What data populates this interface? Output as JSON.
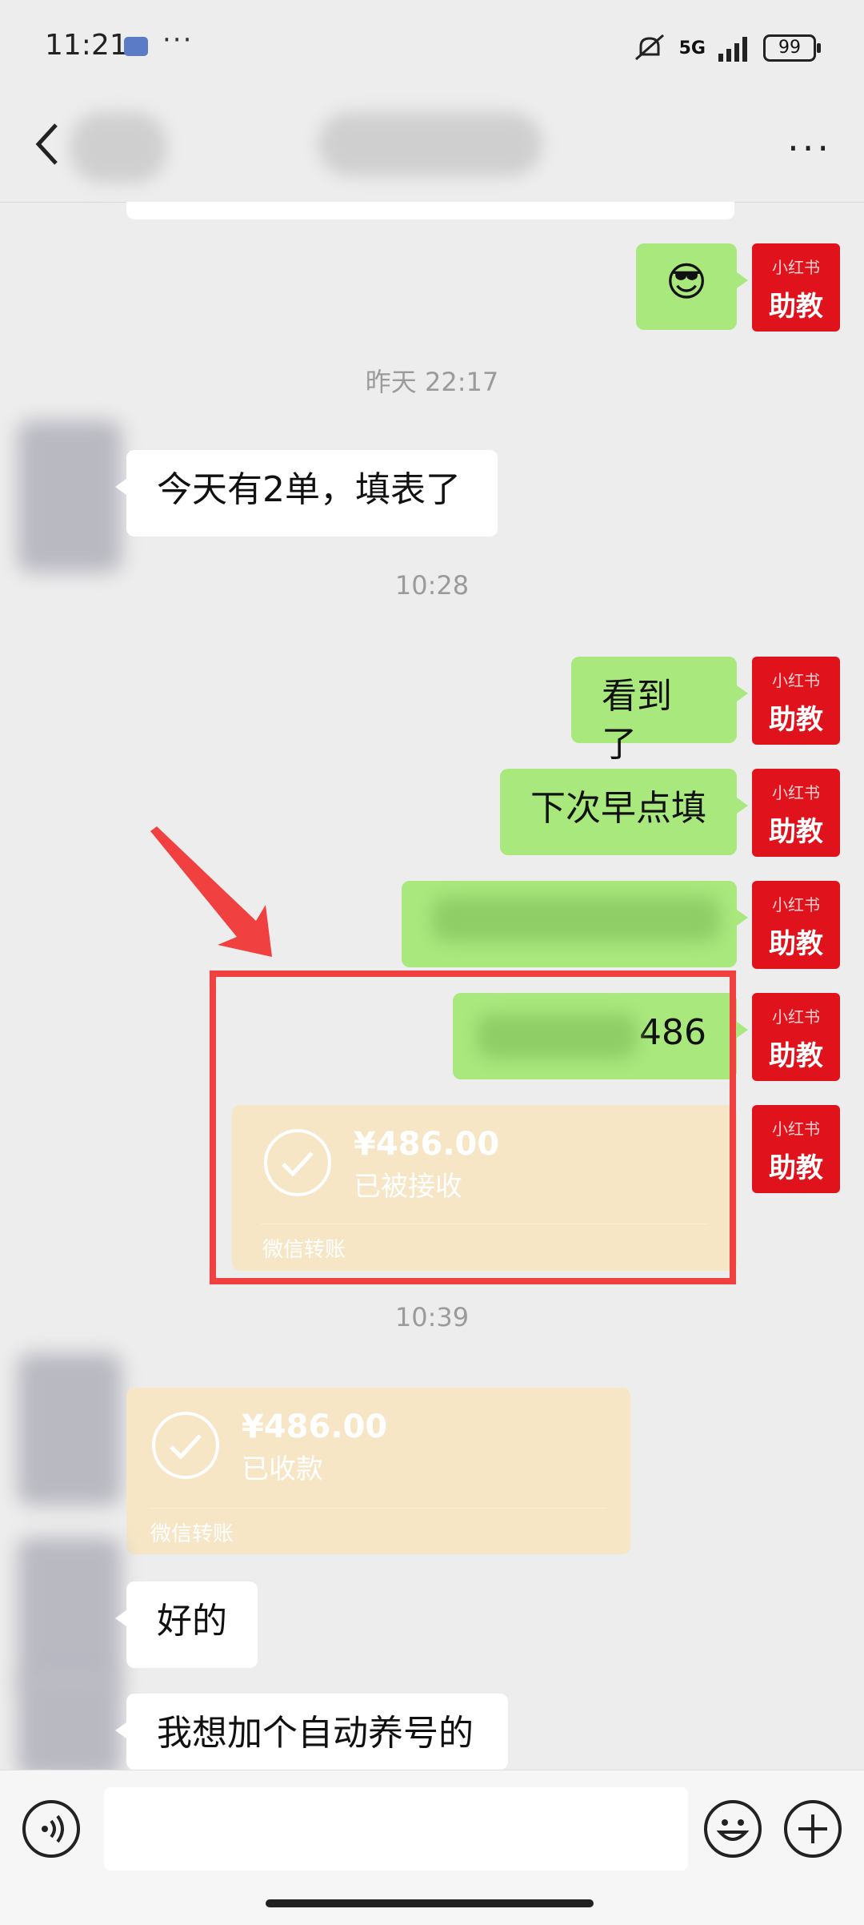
{
  "status_bar": {
    "time": "11:21",
    "network": "5G",
    "battery": "99"
  },
  "header": {
    "more_label": "···"
  },
  "chat": {
    "emoji_msg": "😎",
    "ts1": "昨天 22:17",
    "msg_other_1": "今天有2单，填表了",
    "ts2": "10:28",
    "msg_me_1": "看到了",
    "msg_me_2": "下次早点填",
    "msg_me_4_tail": "486",
    "transfer_sent": {
      "amount": "¥486.00",
      "status": "已被接收",
      "footer": "微信转账"
    },
    "ts3": "10:39",
    "transfer_recv": {
      "amount": "¥486.00",
      "status": "已收款",
      "footer": "微信转账"
    },
    "msg_other_2": "好的",
    "msg_other_3": "我想加个自动养号的"
  },
  "avatar_me": {
    "top": "小红书",
    "bottom": "助教"
  },
  "input_bar": {
    "voice_icon": "voice-icon",
    "emoji_icon": "emoji-icon",
    "plus_icon": "plus-icon"
  },
  "colors": {
    "green_bubble": "#a9e87d",
    "transfer_bg": "#f6e6c6",
    "highlight": "#f04040",
    "avatar_red": "#e0121c"
  }
}
